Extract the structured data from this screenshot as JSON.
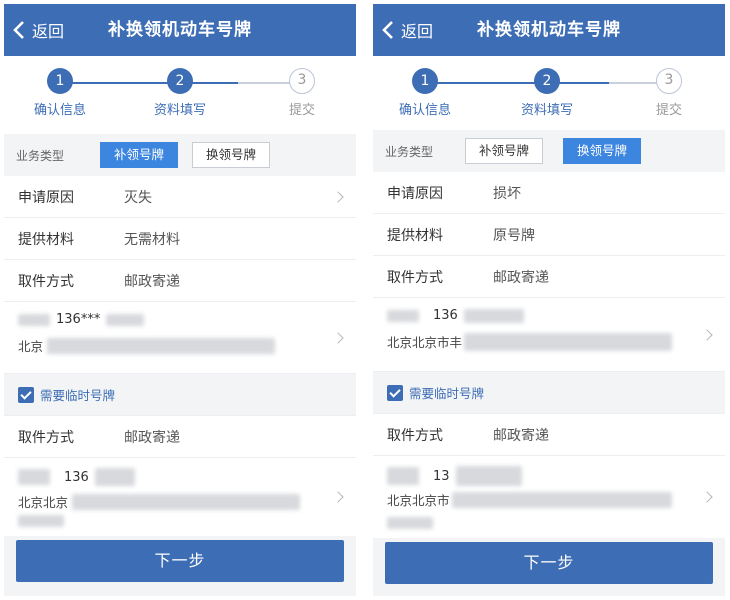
{
  "left": {
    "header": {
      "back_label": "返回",
      "title": "补换领机动车号牌"
    },
    "steps": [
      {
        "num": "1",
        "label": "确认信息",
        "state": "active"
      },
      {
        "num": "2",
        "label": "资料填写",
        "state": "active"
      },
      {
        "num": "3",
        "label": "提交",
        "state": "pending"
      }
    ],
    "type": {
      "label": "业务类型",
      "options": [
        "补领号牌",
        "换领号牌"
      ],
      "selected": "补领号牌"
    },
    "rows": [
      {
        "key": "申请原因",
        "value": "灭失"
      },
      {
        "key": "提供材料",
        "value": "无需材料"
      },
      {
        "key": "取件方式",
        "value": "邮政寄递"
      }
    ],
    "address1": {
      "phone": "136***",
      "address": "北京"
    },
    "temp_plate_label": "需要临时号牌",
    "row_after": {
      "key": "取件方式",
      "value": "邮政寄递"
    },
    "address2": {
      "phone": "136",
      "address": "北京北京"
    },
    "next_label": "下一步"
  },
  "right": {
    "header": {
      "back_label": "返回",
      "title": "补换领机动车号牌"
    },
    "steps": [
      {
        "num": "1",
        "label": "确认信息",
        "state": "active"
      },
      {
        "num": "2",
        "label": "资料填写",
        "state": "active"
      },
      {
        "num": "3",
        "label": "提交",
        "state": "pending"
      }
    ],
    "type": {
      "label": "业务类型",
      "options": [
        "补领号牌",
        "换领号牌"
      ],
      "selected": "换领号牌"
    },
    "rows": [
      {
        "key": "申请原因",
        "value": "损坏"
      },
      {
        "key": "提供材料",
        "value": "原号牌"
      },
      {
        "key": "取件方式",
        "value": "邮政寄递"
      }
    ],
    "address1": {
      "phone": "136",
      "address": "北京北京市丰"
    },
    "temp_plate_label": "需要临时号牌",
    "row_after": {
      "key": "取件方式",
      "value": "邮政寄递"
    },
    "address2": {
      "phone": "13",
      "address": "北京北京市"
    },
    "next_label": "下一步"
  },
  "colors": {
    "primary": "#3d6db5",
    "segment_active": "#3d86e0",
    "background": "#f3f4f6",
    "muted": "#999999"
  },
  "icons": {
    "back": "chevron-left-icon",
    "row_arrow": "chevron-right-icon",
    "checkbox": "checkbox-checked-icon"
  }
}
